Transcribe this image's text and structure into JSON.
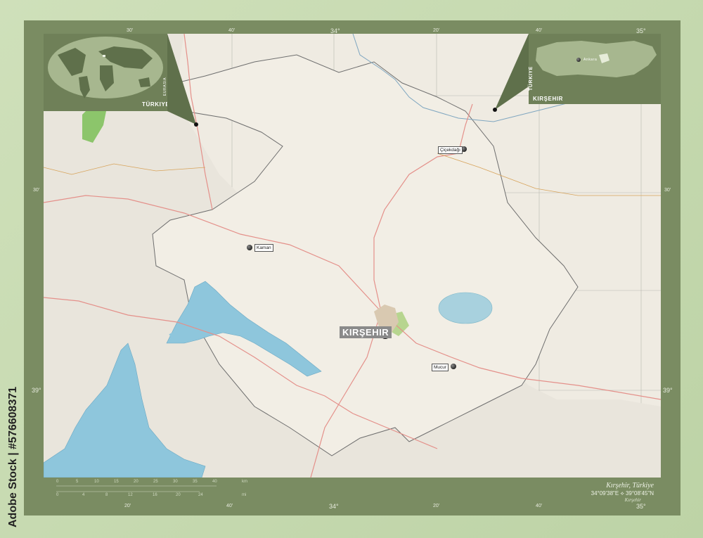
{
  "graticule": {
    "top": [
      "30'",
      "40'",
      "34°",
      "20'",
      "40'",
      "35°"
    ],
    "bottom": [
      "20'",
      "40'",
      "34°",
      "20'",
      "40'",
      "35°"
    ],
    "left": [
      "30'",
      "39°"
    ],
    "right": [
      "30'",
      "39°"
    ]
  },
  "insets": {
    "world_label": "TÜRKIYE",
    "world_side_label": "EURASIA",
    "country_label": "TÜRKIYE",
    "region_label": "KIRŞEHIR",
    "capital_label": "Ankara"
  },
  "cities": {
    "main": "KIRŞEHIR",
    "kaman": "Kaman",
    "cicekdagi": "Çiçekdağı",
    "mucur": "Mucur"
  },
  "footer": {
    "place": "Kırşehir, Türkiye",
    "coords": "34°09'38\"E ⟡ 39°08'45\"N",
    "region": "Kırşehir",
    "scale_km": [
      "0",
      "5",
      "10",
      "15",
      "20",
      "25",
      "30",
      "35",
      "40"
    ],
    "scale_mi": [
      "0",
      "4",
      "8",
      "12",
      "16",
      "20",
      "24"
    ],
    "unit_km": "km",
    "unit_mi": "mi"
  },
  "watermark": "Adobe Stock | #576608371",
  "colors": {
    "land": "#efebe2",
    "water": "#8ec6dc",
    "frame": "#7a8c62",
    "green": "#8cc56b",
    "road": "#e4908a"
  }
}
